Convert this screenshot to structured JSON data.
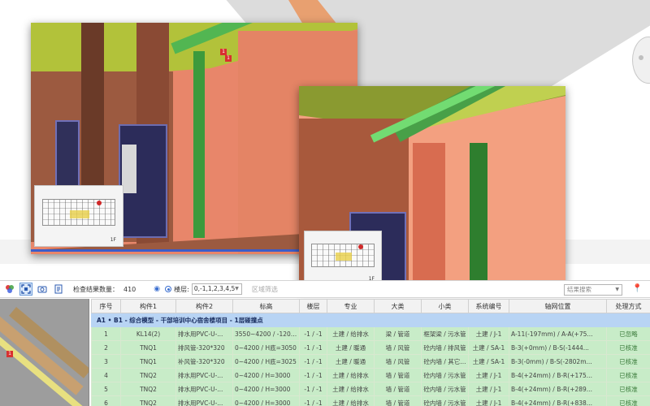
{
  "toolbar": {
    "result_count_label": "检查结果数量：",
    "result_count": "410",
    "floor_label": "楼层:",
    "floor_value": "0,-1,1,2,3,4,5",
    "region_filter_label": "区域筛选",
    "search_placeholder": "结果搜索"
  },
  "viewports": {
    "view1_minimap_floor": "1F",
    "view2_minimap_floor": "1F"
  },
  "table": {
    "columns": [
      "序号",
      "构件1",
      "构件2",
      "标高",
      "楼层",
      "专业",
      "大类",
      "小类",
      "系统编号",
      "轴网位置",
      "处理方式"
    ],
    "group_title": "A1 • B1 - 综合模型 - 干部培训中心宿舍楼项目 - 1层碰撞点",
    "rows": [
      {
        "idx": "1",
        "c1": "KL14(2)",
        "c2": "排水用PVC-U-...",
        "elev": "3550~4200 / -1200~...",
        "floor": "-1 / -1",
        "spec": "土建 / 给排水",
        "cat": "梁 / 管道",
        "sub": "框架梁 / 污水管",
        "sys": "土建 / J-1",
        "axis": "A-11(-197mm) / A-A(+75...",
        "status": "已忽略"
      },
      {
        "idx": "2",
        "c1": "TNQ1",
        "c2": "排风管-320*320",
        "elev": "0~4200 / H底=3050",
        "floor": "-1 / -1",
        "spec": "土建 / 暖通",
        "cat": "墙 / 风管",
        "sub": "砼内墙 / 排风管",
        "sys": "土建 / SA-1",
        "axis": "B-3(+0mm) / B-S(-1444...",
        "status": "已核准"
      },
      {
        "idx": "3",
        "c1": "TNQ1",
        "c2": "补风管-320*320",
        "elev": "0~4200 / H底=3025",
        "floor": "-1 / -1",
        "spec": "土建 / 暖通",
        "cat": "墙 / 风管",
        "sub": "砼内墙 / 其它...",
        "sys": "土建 / SA-1",
        "axis": "B-3(-0mm) / B-S(-2802m...",
        "status": "已核准"
      },
      {
        "idx": "4",
        "c1": "TNQ2",
        "c2": "排水用PVC-U-...",
        "elev": "0~4200 / H=3000",
        "floor": "-1 / -1",
        "spec": "土建 / 给排水",
        "cat": "墙 / 管道",
        "sub": "砼内墙 / 污水管",
        "sys": "土建 / J-1",
        "axis": "B-4(+24mm) / B-R(+175...",
        "status": "已核准"
      },
      {
        "idx": "5",
        "c1": "TNQ2",
        "c2": "排水用PVC-U-...",
        "elev": "0~4200 / H=3000",
        "floor": "-1 / -1",
        "spec": "土建 / 给排水",
        "cat": "墙 / 管道",
        "sub": "砼内墙 / 污水管",
        "sys": "土建 / J-1",
        "axis": "B-4(+24mm) / B-R(+289...",
        "status": "已核准"
      },
      {
        "idx": "6",
        "c1": "TNQ2",
        "c2": "排水用PVC-U-...",
        "elev": "0~4200 / H=3000",
        "floor": "-1 / -1",
        "spec": "土建 / 给排水",
        "cat": "墙 / 管道",
        "sub": "砼内墙 / 污水管",
        "sys": "土建 / J-1",
        "axis": "B-4(+24mm) / B-R(+838...",
        "status": "已核准"
      }
    ]
  },
  "markers": {
    "clash_marker": "1"
  },
  "colors": {
    "accent": "#3b6fd0",
    "group_bg": "#b8d4f4",
    "row_bg": "#c8ecc8",
    "pipe": "#3c9a3c",
    "wall": "#e8866a"
  }
}
